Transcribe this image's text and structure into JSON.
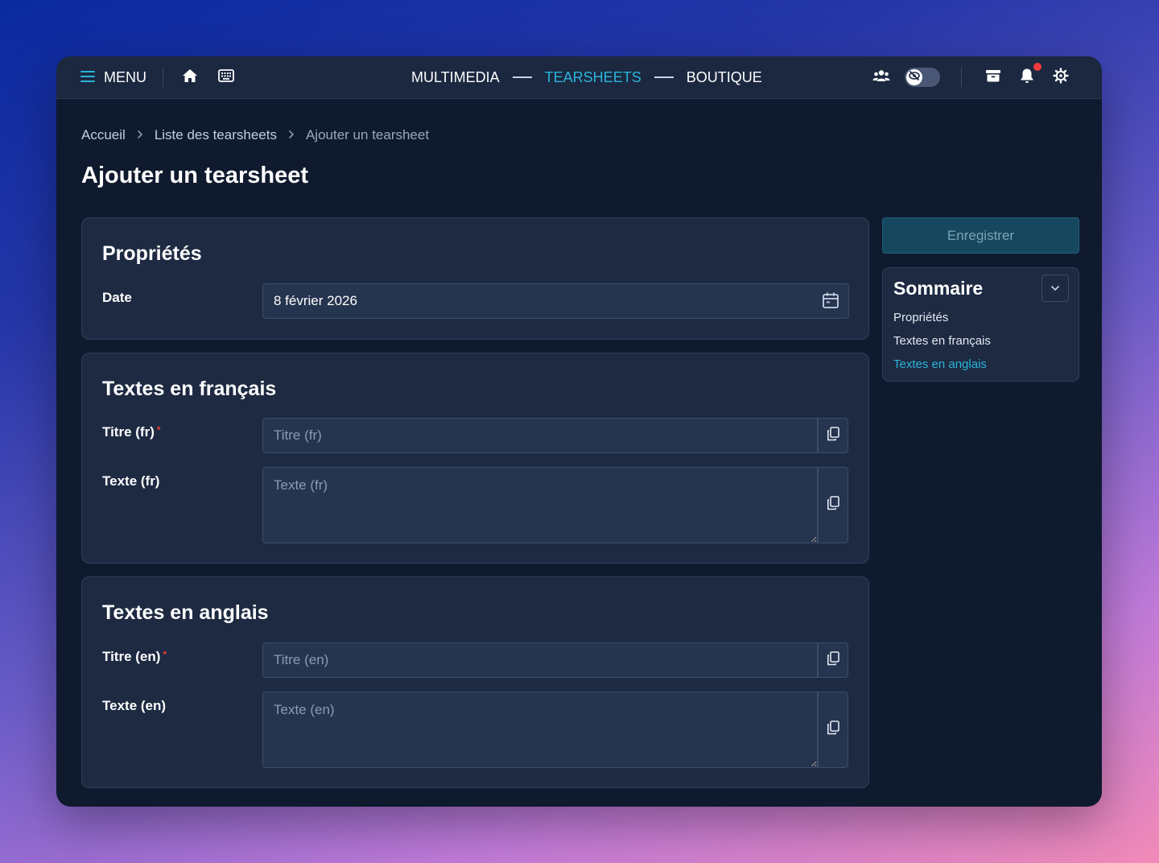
{
  "nav": {
    "menu_label": "MENU",
    "links": [
      {
        "label": "MULTIMEDIA",
        "active": false
      },
      {
        "label": "TEARSHEETS",
        "active": true
      },
      {
        "label": "BOUTIQUE",
        "active": false
      }
    ],
    "notification_badge": true
  },
  "breadcrumb": {
    "items": [
      "Accueil",
      "Liste des tearsheets"
    ],
    "current": "Ajouter un tearsheet"
  },
  "page": {
    "title": "Ajouter un tearsheet"
  },
  "properties": {
    "title": "Propriétés",
    "date_label": "Date",
    "date_value": "8 février 2026"
  },
  "french": {
    "title": "Textes en français",
    "title_label": "Titre (fr)",
    "title_placeholder": "Titre (fr)",
    "text_label": "Texte (fr)",
    "text_placeholder": "Texte (fr)"
  },
  "english": {
    "title": "Textes en anglais",
    "title_label": "Titre (en)",
    "title_placeholder": "Titre (en)",
    "text_label": "Texte (en)",
    "text_placeholder": "Texte (en)"
  },
  "actions": {
    "save_label": "Enregistrer"
  },
  "summary": {
    "title": "Sommaire",
    "items": [
      {
        "label": "Propriétés",
        "active": false
      },
      {
        "label": "Textes en français",
        "active": false
      },
      {
        "label": "Textes en anglais",
        "active": true
      }
    ]
  },
  "colors": {
    "accent": "#2bb4d9",
    "surface": "#1d2a42",
    "background": "#0f1a2e",
    "required": "#ef3b3b"
  }
}
